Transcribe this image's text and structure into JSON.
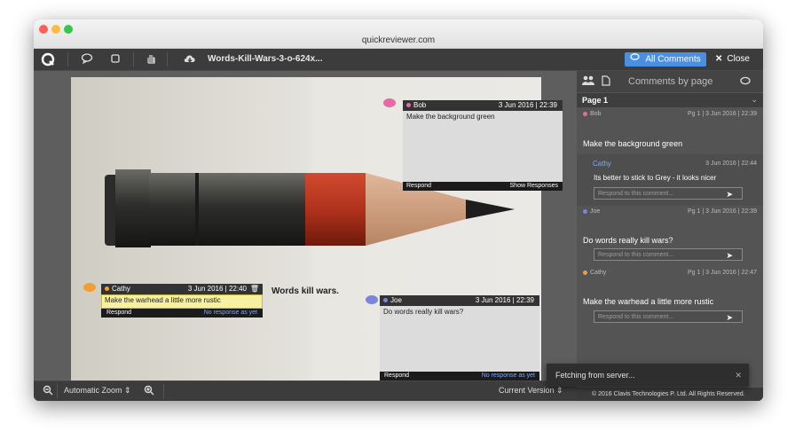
{
  "window": {
    "title": "quickreviewer.com"
  },
  "toolbar": {
    "document_title": "Words-Kill-Wars-3-o-624x...",
    "all_comments_label": "All Comments",
    "close_label": "Close"
  },
  "viewer": {
    "zoom_label": "Automatic Zoom",
    "version_label": "Current Version"
  },
  "artwork": {
    "tagline": "Words kill wars."
  },
  "callouts": {
    "bob": {
      "author": "Bob",
      "date": "3 Jun 2016 | 22:39",
      "text": "Make the background green",
      "respond": "Respond",
      "status": "Show Responses"
    },
    "cathy": {
      "author": "Cathy",
      "date": "3 Jun 2016 | 22:40",
      "text": "Make the warhead a little more rustic",
      "respond": "Respond",
      "status": "No response as yet"
    },
    "joe": {
      "author": "Joe",
      "date": "3 Jun 2016 | 22:39",
      "text": "Do words really kill wars?",
      "respond": "Respond",
      "status": "No response as yet"
    }
  },
  "sidebar": {
    "header_title": "Comments by page",
    "page_label": "Page 1",
    "respond_placeholder": "Respond to this comment...",
    "comments": [
      {
        "author": "Bob",
        "meta": "Pg 1 | 3 Jun 2016 | 22:39",
        "text": "Make the background green"
      },
      {
        "author": "Joe",
        "meta": "Pg 1 | 3 Jun 2016 | 22:39",
        "text": "Do words really kill wars?"
      },
      {
        "author": "Cathy",
        "meta": "Pg 1 | 3 Jun 2016 | 22:47",
        "text": "Make the warhead a little more rustic"
      }
    ],
    "reply": {
      "author": "Cathy",
      "meta": "3 Jun 2016 | 22:44",
      "text": "Its better to stick to Grey - it looks nicer"
    },
    "footer": "© 2016 Clavis Technologies P. Ltd. All Rights Reserved."
  },
  "toast": {
    "text": "Fetching from server..."
  },
  "colors": {
    "accent": "#4a90e2",
    "bob": "#e86aa5",
    "cathy": "#f0a030",
    "joe": "#7b86d9"
  }
}
